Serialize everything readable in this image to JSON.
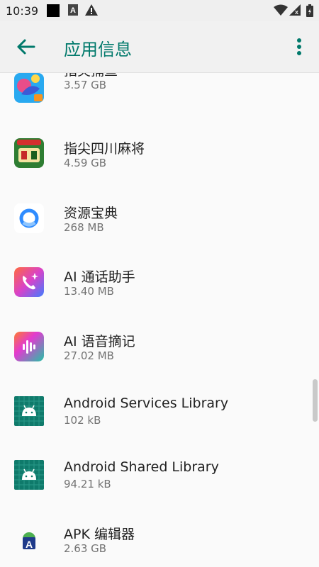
{
  "status_bar": {
    "time": "10:39",
    "icons_left": [
      "black-square-icon",
      "a-notification-icon",
      "warning-icon"
    ],
    "icons_right": [
      "wifi-icon",
      "signal-icon",
      "battery-icon"
    ]
  },
  "app_bar": {
    "title": "应用信息",
    "back_icon": "arrow-left-icon",
    "menu_icon": "more-vert-icon",
    "accent_color": "#00796b"
  },
  "apps": [
    {
      "name": "指尖捕鱼",
      "size": "3.57 GB",
      "icon": "fishing-game-icon"
    },
    {
      "name": "指尖四川麻将",
      "size": "4.59 GB",
      "icon": "mahjong-game-icon"
    },
    {
      "name": "资源宝典",
      "size": "268 MB",
      "icon": "resource-ring-icon"
    },
    {
      "name": "AI 通话助手",
      "size": "13.40 MB",
      "icon": "ai-call-icon"
    },
    {
      "name": "AI 语音摘记",
      "size": "27.02 MB",
      "icon": "ai-voice-icon"
    },
    {
      "name": "Android Services Library",
      "size": "102 kB",
      "icon": "android-default-icon"
    },
    {
      "name": "Android Shared Library",
      "size": "94.21 kB",
      "icon": "android-default-icon"
    },
    {
      "name": "APK 编辑器",
      "size": "2.63 GB",
      "icon": "apk-editor-icon"
    }
  ]
}
